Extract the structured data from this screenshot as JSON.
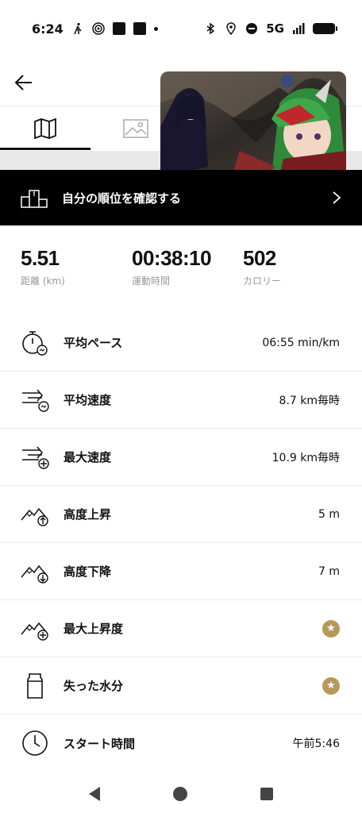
{
  "status": {
    "time": "6:24",
    "network": "5G",
    "icons": [
      "walk-icon",
      "target-icon",
      "app-icon",
      "app-icon",
      "bluetooth-icon",
      "location-icon",
      "dnd-icon",
      "signal-icon",
      "battery-icon"
    ]
  },
  "ranking": {
    "label": "自分の順位を確認する"
  },
  "summary": [
    {
      "value": "5.51",
      "label": "距離 (km)"
    },
    {
      "value": "00:38:10",
      "label": "運動時間"
    },
    {
      "value": "502",
      "label": "カロリー"
    }
  ],
  "metrics": [
    {
      "icon": "stopwatch-icon",
      "name": "平均ペース",
      "value": "06:55 min/km"
    },
    {
      "icon": "avg-speed-icon",
      "name": "平均速度",
      "value": "8.7 km毎時"
    },
    {
      "icon": "max-speed-icon",
      "name": "最大速度",
      "value": "10.9 km毎時"
    },
    {
      "icon": "elevation-gain-icon",
      "name": "高度上昇",
      "value": "5 m"
    },
    {
      "icon": "elevation-loss-icon",
      "name": "高度下降",
      "value": "7 m"
    },
    {
      "icon": "max-ascent-icon",
      "name": "最大上昇度",
      "value": "★"
    },
    {
      "icon": "water-bottle-icon",
      "name": "失った水分",
      "value": "★"
    },
    {
      "icon": "clock-icon",
      "name": "スタート時間",
      "value": "午前5:46"
    }
  ],
  "colors": {
    "accent_gold": "#b8985a",
    "banner_bg": "#000000"
  }
}
